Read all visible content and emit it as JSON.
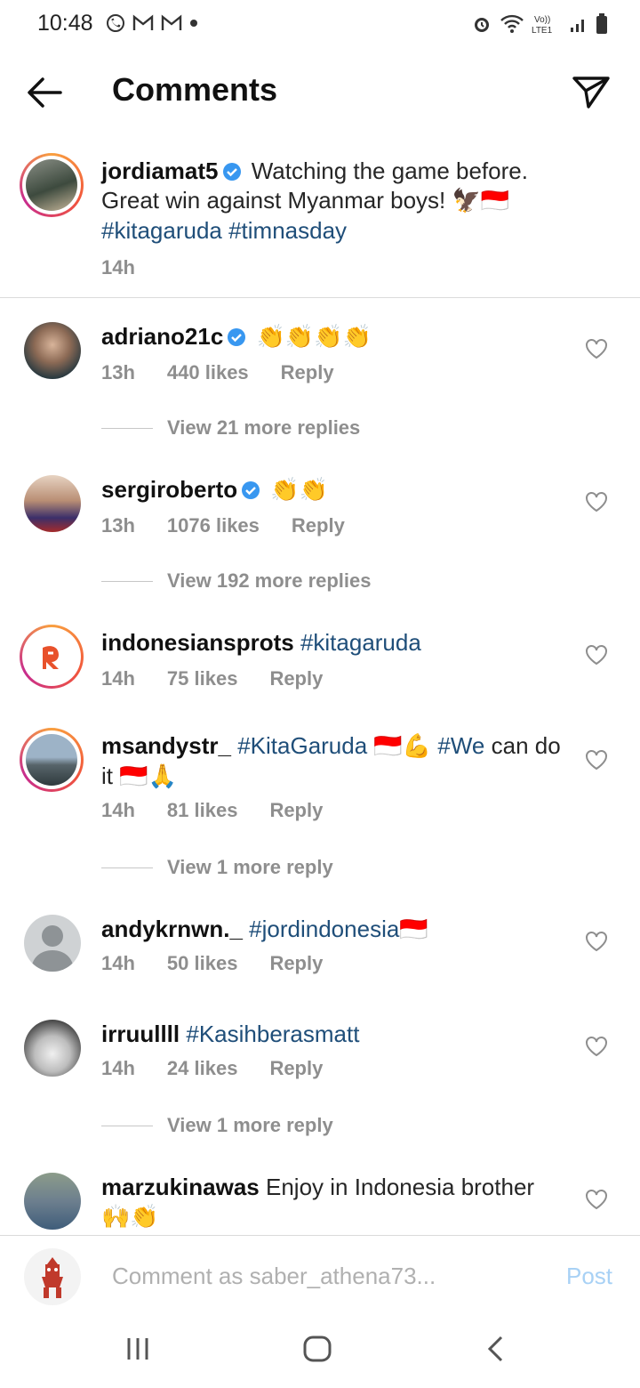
{
  "status_bar": {
    "time": "10:48"
  },
  "header": {
    "title": "Comments"
  },
  "caption": {
    "username": "jordiamat5",
    "text": "Watching the game before. Great win against Myanmar boys!",
    "hashtags": "#kitagaruda #timnasday",
    "time": "14h"
  },
  "comments": [
    {
      "username": "adriano21c",
      "text": "",
      "time": "13h",
      "likes": "440 likes",
      "reply": "Reply",
      "view_more": "View 21 more replies"
    },
    {
      "username": "sergiroberto",
      "text": "",
      "time": "13h",
      "likes": "1076 likes",
      "reply": "Reply",
      "view_more": "View 192 more replies"
    },
    {
      "username": "indonesiansprots",
      "tag": "#kitagaruda",
      "time": "14h",
      "likes": "75 likes",
      "reply": "Reply"
    },
    {
      "username": "msandystr_",
      "tag": "#KitaGaruda",
      "tag2": "#We",
      "text": "can do it",
      "time": "14h",
      "likes": "81 likes",
      "reply": "Reply",
      "view_more": "View 1 more reply"
    },
    {
      "username": "andykrnwn._",
      "tag": "#jordindonesia",
      "time": "14h",
      "likes": "50 likes",
      "reply": "Reply"
    },
    {
      "username": "irruullll",
      "tag": "#Kasihberasmatt",
      "time": "14h",
      "likes": "24 likes",
      "reply": "Reply",
      "view_more": "View 1 more reply"
    },
    {
      "username": "marzukinawas",
      "text": "Enjoy in Indonesia brother"
    }
  ],
  "composer": {
    "placeholder": "Comment as saber_athena73...",
    "post_label": "Post"
  },
  "colors": {
    "link": "#1f4e79",
    "post_disabled": "#a8d1f5",
    "verified": "#3897f0"
  }
}
